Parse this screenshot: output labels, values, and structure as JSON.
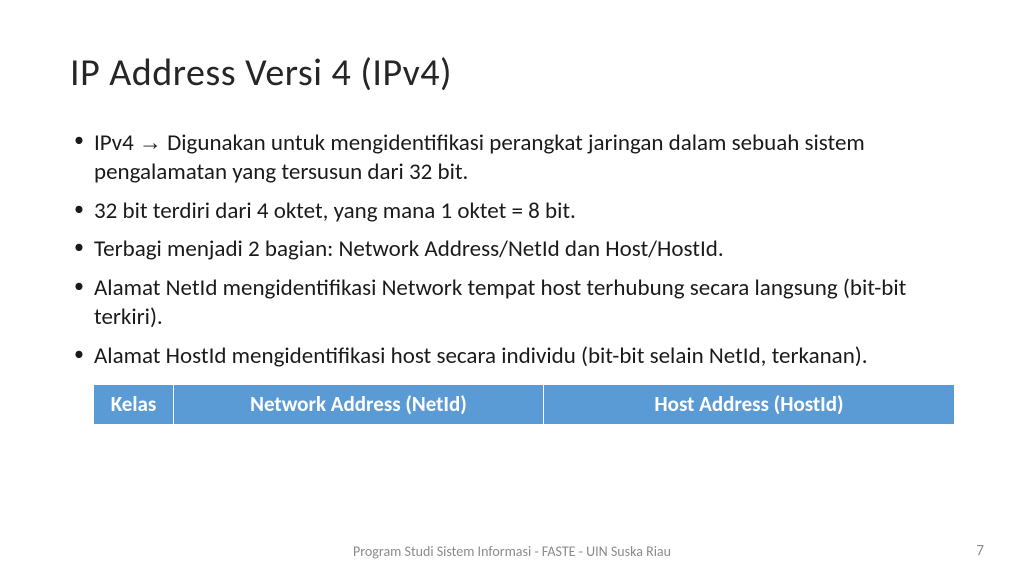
{
  "title": "IP Address Versi 4 (IPv4)",
  "bullets": [
    {
      "prefix": "IPv4 ",
      "arrow": "→",
      "rest": " Digunakan untuk mengidentifikasi perangkat jaringan dalam sebuah sistem pengalamatan yang tersusun dari 32 bit."
    },
    {
      "text": "32 bit terdiri dari 4 oktet, yang mana 1 oktet = 8 bit."
    },
    {
      "text": "Terbagi menjadi 2 bagian: Network Address/NetId dan Host/HostId."
    },
    {
      "text": "Alamat NetId mengidentifikasi Network tempat host terhubung secara langsung (bit-bit terkiri)."
    },
    {
      "text": "Alamat HostId mengidentifikasi host secara individu (bit-bit selain NetId, terkanan)."
    }
  ],
  "table": {
    "headers": {
      "kelas": "Kelas",
      "net": "Network Address (NetId)",
      "host": "Host Address (HostId)"
    }
  },
  "footer": "Program Studi Sistem Informasi - FASTE - UIN Suska Riau",
  "page": "7"
}
